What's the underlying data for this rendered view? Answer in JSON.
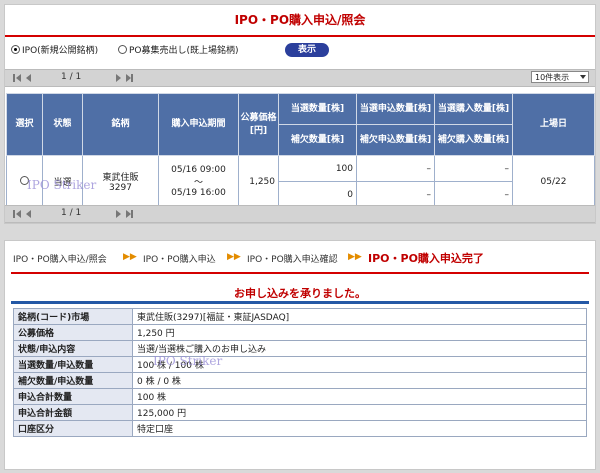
{
  "top": {
    "title": "IPO・PO購入申込/照会",
    "option_ipo": "IPO(新規公開銘柄)",
    "option_po": "PO募集売出し(既上場銘柄)",
    "show_button": "表示",
    "pager_text": "1 / 1",
    "per_page": "10件表示",
    "headers": {
      "select": "選択",
      "status": "状態",
      "issue": "銘柄",
      "period": "購入申込期間",
      "price": "公募価格[円]",
      "win_qty": "当選数量[株]",
      "win_apply_qty": "当選申込数量[株]",
      "win_purchase_qty": "当選購入数量[株]",
      "sub_qty": "補欠数量[株]",
      "sub_apply_qty": "補欠申込数量[株]",
      "sub_purchase_qty": "補欠購入数量[株]",
      "listing_date": "上場日"
    },
    "row": {
      "status": "当選",
      "issue_name": "東武住販",
      "issue_code": "3297",
      "period_start": "05/16 09:00",
      "period_sep": "〜",
      "period_end": "05/19 16:00",
      "price": "1,250",
      "win_qty": "100",
      "win_apply": "–",
      "win_purchase": "–",
      "sub_qty": "0",
      "sub_apply": "–",
      "sub_purchase": "–",
      "listing_date": "05/22"
    }
  },
  "bottom": {
    "breadcrumb": [
      "IPO・PO購入申込/照会",
      "IPO・PO購入申込",
      "IPO・PO購入申込確認",
      "IPO・PO購入申込完了"
    ],
    "message": "お申し込みを承りました。",
    "rows": [
      {
        "label": "銘柄(コード)市場",
        "value": "東武住販(3297)[福証・東証JASDAQ]"
      },
      {
        "label": "公募価格",
        "value": "1,250 円"
      },
      {
        "label": "状態/申込内容",
        "value": "当選/当選株ご購入のお申し込み"
      },
      {
        "label": "当選数量/申込数量",
        "value": "100 株 / 100 株"
      },
      {
        "label": "補欠数量/申込数量",
        "value": "0 株 / 0 株"
      },
      {
        "label": "申込合計数量",
        "value": "100 株"
      },
      {
        "label": "申込合計金額",
        "value": "125,000 円"
      },
      {
        "label": "口座区分",
        "value": "特定口座"
      }
    ]
  },
  "watermark": "IPO Striker",
  "colors": {
    "accent_red": "#c00000",
    "header_blue": "#4f6fa6",
    "button_blue": "#2b3f9c",
    "bar_blue": "#2458a6"
  }
}
